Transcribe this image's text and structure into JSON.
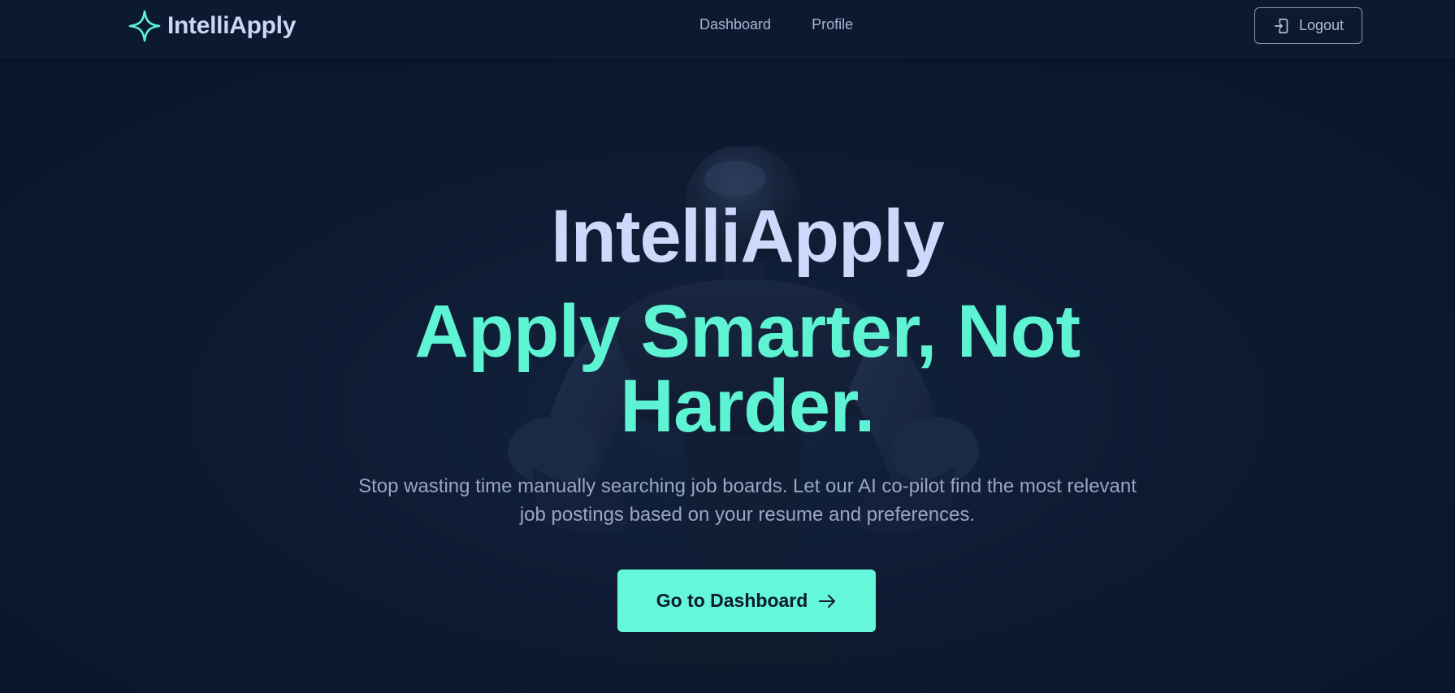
{
  "navbar": {
    "brand_name": "IntelliApply",
    "links": [
      {
        "label": "Dashboard"
      },
      {
        "label": "Profile"
      }
    ],
    "logout_label": "Logout"
  },
  "hero": {
    "title": "IntelliApply",
    "tagline": "Apply Smarter, Not Harder.",
    "description": "Stop wasting time manually searching job boards. Let our AI co-pilot find the most relevant job postings based on your resume and preferences.",
    "cta_label": "Go to Dashboard"
  },
  "icons": {
    "brand": "sparkle-star-icon",
    "logout": "logout-door-icon",
    "cta": "arrow-right-icon"
  },
  "colors": {
    "background": "#0b172e",
    "navbar": "#0c1a31",
    "accent": "#64f7d9",
    "title": "#cfd8fa",
    "muted_text": "#9aa6c2"
  }
}
